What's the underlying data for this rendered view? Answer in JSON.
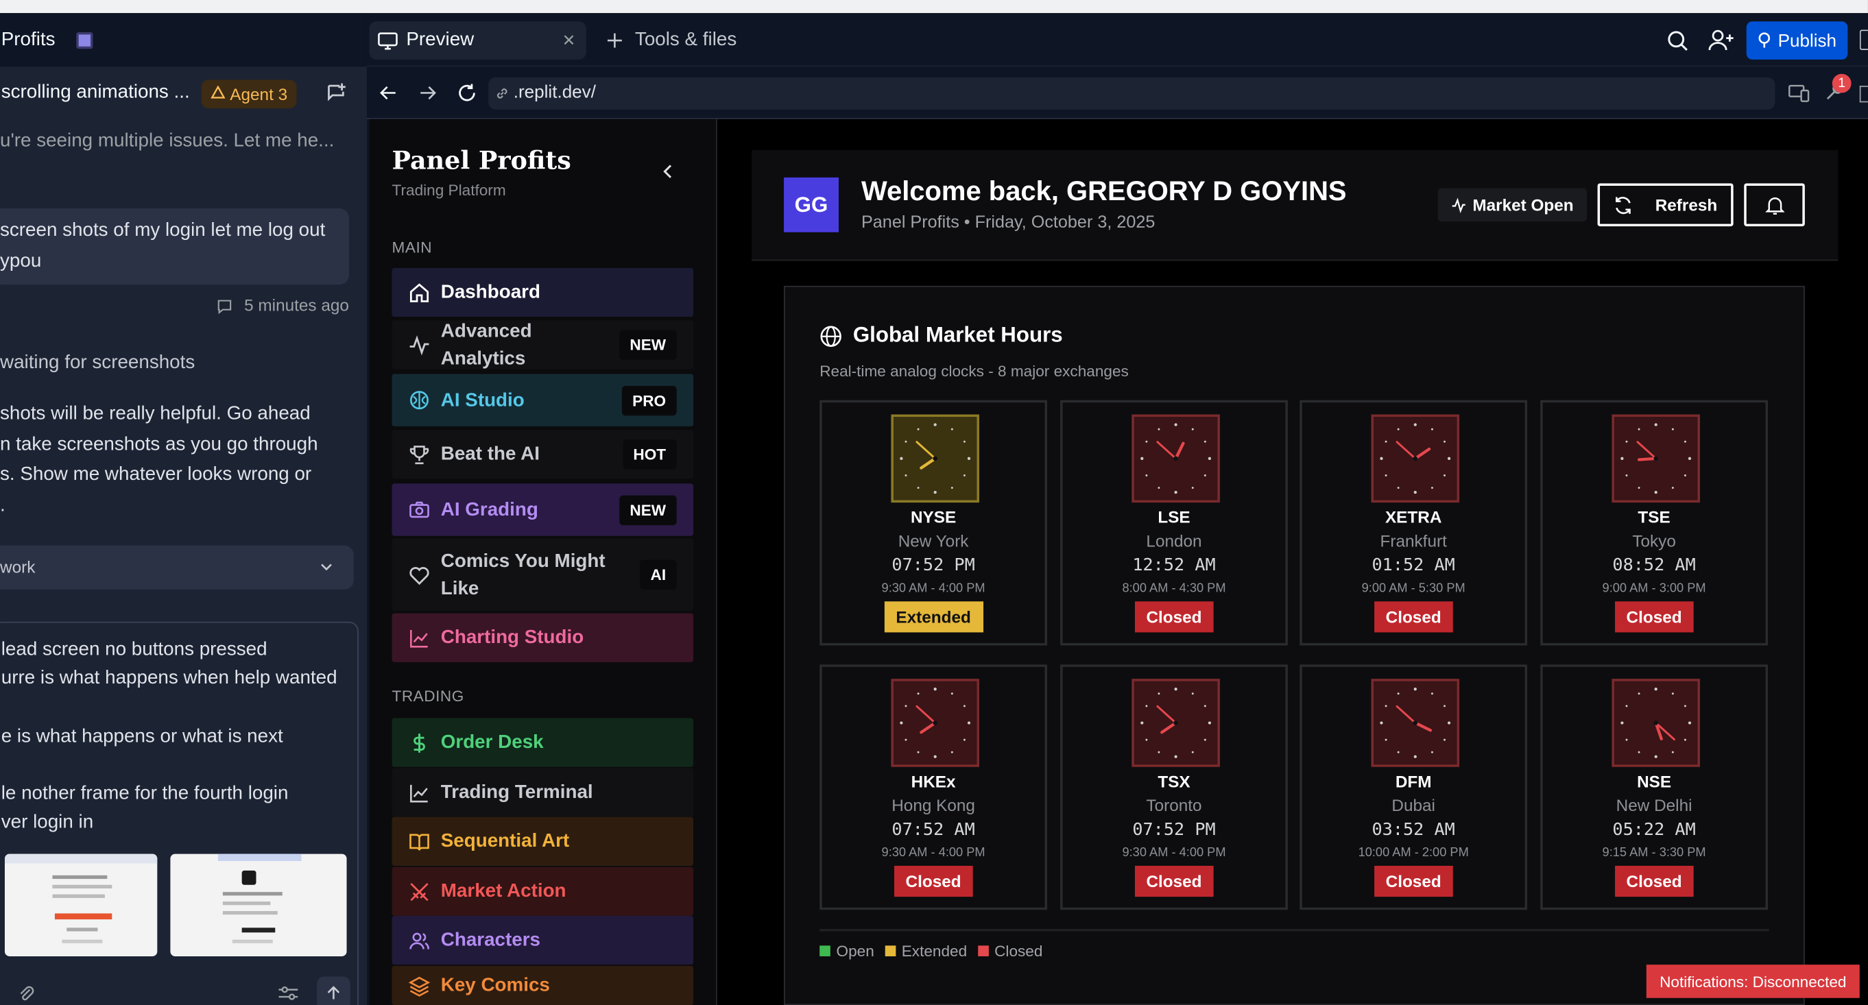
{
  "colors": {
    "accent_blue": "#0053d6",
    "open": "#3fb950",
    "extended": "#e5b83a",
    "closed": "#c0272d",
    "avatar": "#4a3de0"
  },
  "workspace": {
    "project_title": "Profits",
    "thread_title": "scrolling animations ...",
    "agent_badge": "Agent 3",
    "messages": {
      "agent_intro": "u're seeing multiple issues. Let me he...",
      "user_msg_lines": [
        "screen shots of my login let me log out",
        "ypou"
      ],
      "user_msg_time": "5 minutes ago",
      "agent_status": "waiting for screenshots",
      "agent_reply_lines": [
        "shots will be really helpful. Go ahead",
        "n take screenshots as you go through",
        "s. Show me whatever looks wrong or",
        "."
      ],
      "work_dropdown": "work",
      "compose_lines": [
        "lead screen no buttons pressed",
        "urre is what happens when help wanted",
        "e is what happens or what is next",
        "le nother frame for the fourth login",
        "ver login in"
      ]
    }
  },
  "preview": {
    "tab_preview": "Preview",
    "tab_tools": "Tools & files",
    "url": ".replit.dev/",
    "publish_label": "Publish",
    "notification_count": "1"
  },
  "app": {
    "brand": "Panel Profits",
    "brand_sub": "Trading Platform",
    "section_main": "MAIN",
    "section_trading": "TRADING",
    "nav": [
      {
        "label": "Dashboard",
        "badge": "",
        "icon": "home-icon",
        "bg": "#1b1b33",
        "color": "#ffffff"
      },
      {
        "label": "Advanced Analytics",
        "badge": "NEW",
        "icon": "activity-icon",
        "bg": "#111114",
        "color": "#c9cbd0"
      },
      {
        "label": "AI Studio",
        "badge": "PRO",
        "icon": "brain-icon",
        "bg": "#142a33",
        "color": "#55c8e8"
      },
      {
        "label": "Beat the AI",
        "badge": "HOT",
        "icon": "trophy-icon",
        "bg": "#111114",
        "color": "#c9cbd0"
      },
      {
        "label": "AI Grading",
        "badge": "NEW",
        "icon": "camera-icon",
        "bg": "#2a1a45",
        "color": "#b48cf2"
      },
      {
        "label": "Comics You Might Like",
        "badge": "AI",
        "icon": "heart-icon",
        "bg": "#111114",
        "color": "#c9cbd0"
      },
      {
        "label": "Charting Studio",
        "badge": "",
        "icon": "chart-line-icon",
        "bg": "#3a1525",
        "color": "#ef6aa0"
      },
      {
        "label": "Order Desk",
        "badge": "",
        "icon": "dollar-icon",
        "bg": "#10271a",
        "color": "#4fd17b"
      },
      {
        "label": "Trading Terminal",
        "badge": "",
        "icon": "chart-line-icon",
        "bg": "#111114",
        "color": "#c9cbd0"
      },
      {
        "label": "Sequential Art",
        "badge": "",
        "icon": "book-icon",
        "bg": "#2e1d0f",
        "color": "#f2b23a"
      },
      {
        "label": "Market Action",
        "badge": "",
        "icon": "swords-icon",
        "bg": "#331314",
        "color": "#f25757"
      },
      {
        "label": "Characters",
        "badge": "",
        "icon": "users-icon",
        "bg": "#221a3a",
        "color": "#b48cf2"
      },
      {
        "label": "Key Comics",
        "badge": "",
        "icon": "layers-icon",
        "bg": "#2e1c0f",
        "color": "#f28a3a"
      }
    ],
    "avatar_initials": "GG",
    "welcome": "Welcome back, GREGORY D GOYINS",
    "subline": "Panel Profits • Friday, October 3, 2025",
    "market_open_label": "Market Open",
    "refresh_label": "Refresh",
    "market_hours_title": "Global Market Hours",
    "market_hours_sub": "Real-time analog clocks - 8 major exchanges",
    "exchanges": [
      {
        "code": "NYSE",
        "city": "New York",
        "time": "07:52 PM",
        "hours": "9:30 AM - 4:00 PM",
        "status": "Extended",
        "h": 19,
        "m": 52
      },
      {
        "code": "LSE",
        "city": "London",
        "time": "12:52 AM",
        "hours": "8:00 AM - 4:30 PM",
        "status": "Closed",
        "h": 0,
        "m": 52
      },
      {
        "code": "XETRA",
        "city": "Frankfurt",
        "time": "01:52 AM",
        "hours": "9:00 AM - 5:30 PM",
        "status": "Closed",
        "h": 1,
        "m": 52
      },
      {
        "code": "TSE",
        "city": "Tokyo",
        "time": "08:52 AM",
        "hours": "9:00 AM - 3:00 PM",
        "status": "Closed",
        "h": 8,
        "m": 52
      },
      {
        "code": "HKEx",
        "city": "Hong Kong",
        "time": "07:52 AM",
        "hours": "9:30 AM - 4:00 PM",
        "status": "Closed",
        "h": 7,
        "m": 52
      },
      {
        "code": "TSX",
        "city": "Toronto",
        "time": "07:52 PM",
        "hours": "9:30 AM - 4:00 PM",
        "status": "Closed",
        "h": 19,
        "m": 52
      },
      {
        "code": "DFM",
        "city": "Dubai",
        "time": "03:52 AM",
        "hours": "10:00 AM - 2:00 PM",
        "status": "Closed",
        "h": 3,
        "m": 52
      },
      {
        "code": "NSE",
        "city": "New Delhi",
        "time": "05:22 AM",
        "hours": "9:15 AM - 3:30 PM",
        "status": "Closed",
        "h": 5,
        "m": 22
      }
    ],
    "legend": [
      "Open",
      "Extended",
      "Closed"
    ],
    "notification": "Notifications: Disconnected"
  }
}
